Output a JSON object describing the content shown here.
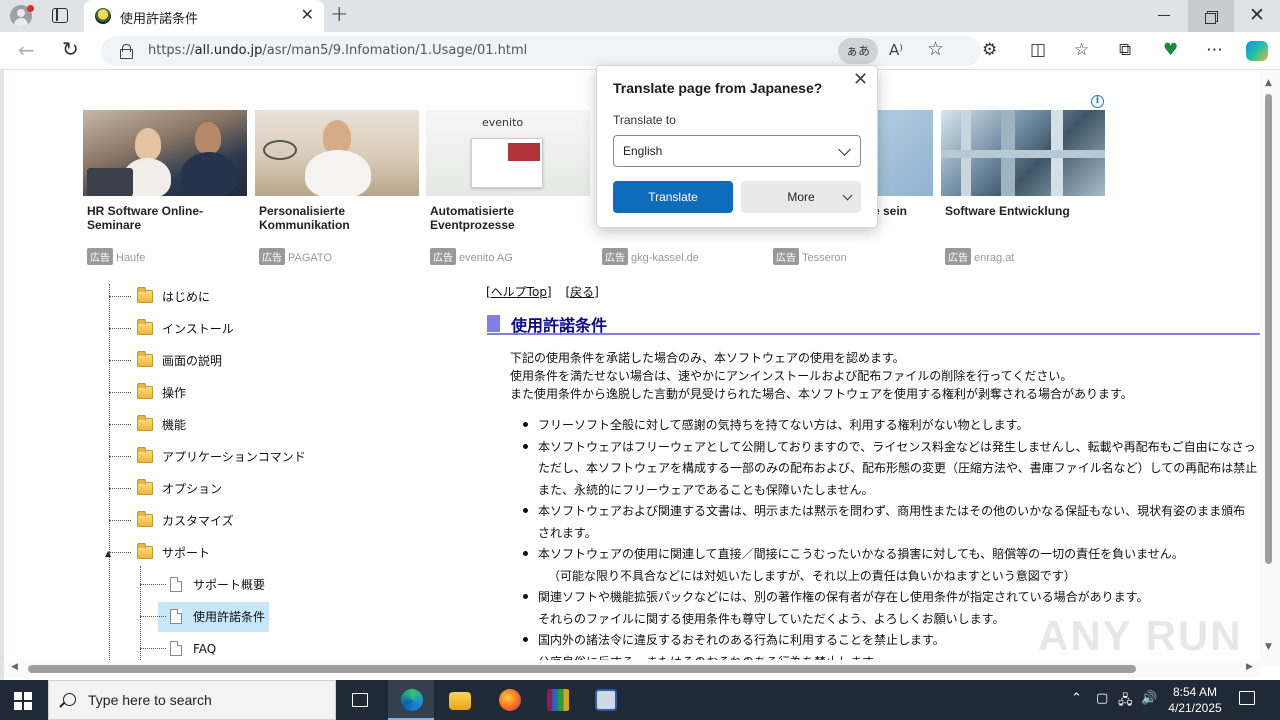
{
  "browser": {
    "tab_title": "使用許諾条件",
    "url_prefix": "https://",
    "url_host": "all.undo.jp",
    "url_path": "/asr/man5/9.Infomation/1.Usage/01.html",
    "translate_chip": "ぁあ",
    "icons": [
      "profile-icon",
      "tab-actions-icon",
      "close-icon",
      "new-tab-icon",
      "back-icon",
      "reload-icon",
      "lock-icon",
      "translate-icon",
      "read-aloud-icon",
      "favorite-star-icon",
      "extensions-icon",
      "split-screen-icon",
      "favorites-icon",
      "collections-icon",
      "performance-icon",
      "more-icon",
      "copilot-icon",
      "minimize-icon",
      "restore-icon",
      "close-window-icon"
    ]
  },
  "ads": {
    "badge": "広告",
    "items": [
      {
        "title": "HR Software Online-Seminare",
        "source": "Haufe"
      },
      {
        "title": "Personalisierte Kommunikation",
        "source": "PAGATO"
      },
      {
        "title": "Automatisierte Eventprozesse",
        "source": "evenito AG",
        "logo": "evenito"
      },
      {
        "title": "",
        "source": "gkg-kassel.de"
      },
      {
        "title": "e sein",
        "source": "Tesseron"
      },
      {
        "title": "Software Entwicklung",
        "source": "enrag.at"
      }
    ]
  },
  "translate_popup": {
    "title": "Translate page from Japanese?",
    "label": "Translate to",
    "selected_language": "English",
    "translate_button": "Translate",
    "more_button": "More"
  },
  "tree": {
    "items": [
      {
        "label": "はじめに",
        "type": "folder"
      },
      {
        "label": "インストール",
        "type": "folder"
      },
      {
        "label": "画面の説明",
        "type": "folder"
      },
      {
        "label": "操作",
        "type": "folder"
      },
      {
        "label": "機能",
        "type": "folder"
      },
      {
        "label": "アプリケーションコマンド",
        "type": "folder"
      },
      {
        "label": "オプション",
        "type": "folder"
      },
      {
        "label": "カスタマイズ",
        "type": "folder"
      },
      {
        "label": "サポート",
        "type": "folder",
        "expanded": true
      }
    ],
    "children": [
      {
        "label": "サポート概要",
        "type": "page"
      },
      {
        "label": "使用許諾条件",
        "type": "page",
        "selected": true
      },
      {
        "label": "FAQ",
        "type": "page"
      }
    ]
  },
  "content": {
    "help_top": "[ヘルプTop]",
    "back": "[戻る]",
    "heading": "使用許諾条件",
    "intro": [
      "下記の使用条件を承諾した場合のみ、本ソフトウェアの使用を認めます。",
      "使用条件を満たせない場合は、速やかにアンインストールおよび配布ファイルの削除を行ってください。",
      "また使用条件から逸脱した言動が見受けられた場合、本ソフトウェアを使用する権利が剥奪される場合があります。"
    ],
    "rules": [
      {
        "lines": [
          "フリーソフト全般に対して感謝の気持ちを持てない方は、利用する権利がない物とします。"
        ]
      },
      {
        "lines": [
          "本ソフトウェアはフリーウェアとして公開しておりますので、ライセンス料金などは発生しませんし、転載や再配布もご自由になさっ",
          "ただし、本ソフトウェアを構成する一部のみの配布および、配布形態の変更（圧縮方法や、書庫ファイル名など）しての再配布は禁止",
          "また、永続的にフリーウェアであることも保障いたしません。"
        ]
      },
      {
        "lines": [
          "本ソフトウェアおよび関連する文書は、明示または黙示を問わず、商用性またはその他のいかなる保証もない、現状有姿のまま頒布",
          "されます。"
        ]
      },
      {
        "lines": [
          "本ソフトウェアの使用に関連して直接／間接にこうむったいかなる損害に対しても、賠償等の一切の責任を負いません。",
          "（可能な限り不具合などには対処いたしますが、それ以上の責任は負いかねますという意図です）"
        ]
      },
      {
        "lines": [
          "関連ソフトや機能拡張パックなどには、別の著作権の保有者が存在し使用条件が指定されている場合があります。",
          "それらのファイルに関する使用条件も尊守していただくよう、よろしくお願いします。"
        ]
      },
      {
        "lines": [
          "国内外の諸法令に違反するおそれのある行為に利用することを禁止します。",
          "公序良俗に反する、またはそのおそれのある行為を禁止します。"
        ]
      }
    ]
  },
  "watermark": "ANY RUN",
  "taskbar": {
    "search_placeholder": "Type here to search",
    "time": "8:54 AM",
    "date": "4/21/2025",
    "apps": [
      "task-view-icon",
      "edge-icon",
      "file-explorer-icon",
      "firefox-icon",
      "winrar-icon",
      "network-tool-icon"
    ]
  }
}
